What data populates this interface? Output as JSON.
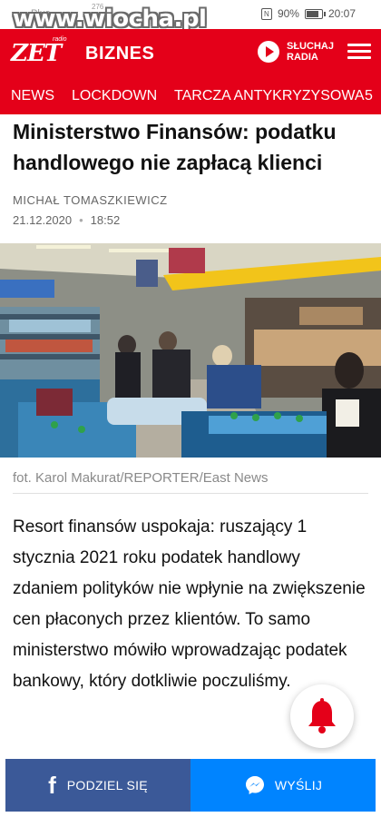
{
  "status_bar": {
    "left_text": "Plus",
    "tiny_text": "276",
    "watermark": "www.wiocha.pl",
    "battery": "90%",
    "time": "20:07"
  },
  "header": {
    "logo_text": "ZET",
    "logo_sub": "radio",
    "section": "BIZNES",
    "listen_label": "SŁUCHAJ RADIA"
  },
  "nav": {
    "items": [
      "NEWS",
      "LOCKDOWN",
      "TARCZA ANTYKRYZYSOWA",
      "5"
    ]
  },
  "article": {
    "title": "Ministerstwo Finansów: podatku handlowego nie zapłacą klienci",
    "author": "MICHAŁ TOMASZKIEWICZ",
    "date": "21.12.2020",
    "time": "18:52",
    "photo_caption": "fot. Karol Makurat/REPORTER/East News",
    "lead": "Resort finansów uspokaja: ruszający 1 stycznia 2021 roku podatek handlowy zdaniem polityków nie wpłynie na zwiększenie cen płaconych przez klientów. To samo ministerstwo mówiło wprowadzając podatek bankowy, który dotkliwie poczuliśmy."
  },
  "share": {
    "facebook_label": "PODZIEL SIĘ",
    "messenger_label": "WYŚLIJ"
  },
  "colors": {
    "brand_red": "#e40019",
    "facebook_blue": "#3b5998",
    "messenger_blue": "#0084ff"
  }
}
